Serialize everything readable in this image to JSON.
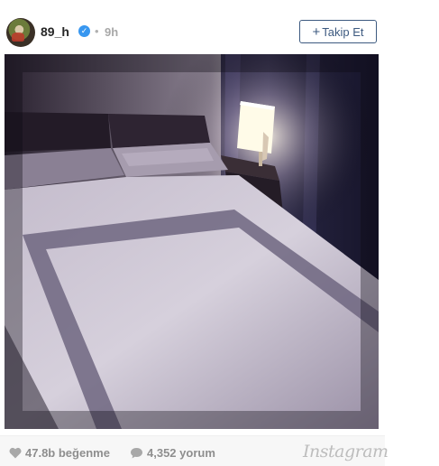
{
  "post": {
    "username": "89_h",
    "verified_mark": "✓",
    "separator": "•",
    "time_ago": "9h",
    "follow_label": "Takip Et",
    "follow_plus": "+",
    "image_alt_icon": "bedroom-photo"
  },
  "footer": {
    "likes": "47.8b beğenme",
    "comments": "4,352 yorum",
    "logo": "Instagram",
    "heart_icon": "heart-icon",
    "comment_icon": "comment-bubble-icon"
  },
  "colors": {
    "follow_border": "#3d5a80",
    "verified": "#3897f0",
    "muted_text": "#8e8e8e"
  }
}
